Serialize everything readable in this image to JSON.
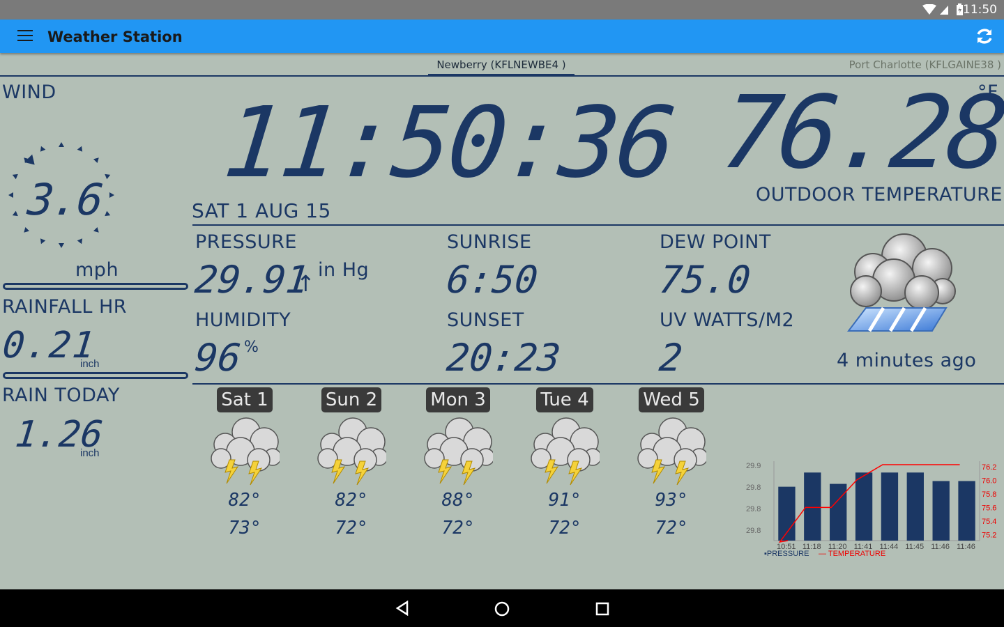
{
  "status_bar": {
    "time": "11:50"
  },
  "app_bar": {
    "title": "Weather Station"
  },
  "tabs": {
    "active": "Newberry (KFLNEWBE4 )",
    "inactive": "Port Charlotte (KFLGAINE38 )"
  },
  "wind": {
    "label": "WIND",
    "speed": "3.6",
    "unit": "mph"
  },
  "rainfall_hr": {
    "label": "RAINFALL HR",
    "value": "0.21",
    "unit": "inch"
  },
  "rain_today": {
    "label": "RAIN TODAY",
    "value": "1.26",
    "unit": "inch"
  },
  "clock": {
    "time": "11:50:36",
    "date": "SAT 1 AUG 15"
  },
  "outdoor": {
    "value": "76.28",
    "unit": "°F",
    "label": "OUTDOOR TEMPERATURE"
  },
  "pressure": {
    "label": "PRESSURE",
    "value": "29.91",
    "trend": "↑",
    "unit": "in Hg"
  },
  "humidity": {
    "label": "HUMIDITY",
    "value": "96",
    "unit": "%"
  },
  "sunrise": {
    "label": "SUNRISE",
    "value": "6:50"
  },
  "sunset": {
    "label": "SUNSET",
    "value": "20:23"
  },
  "dew_point": {
    "label": "DEW POINT",
    "value": "75.0"
  },
  "uv": {
    "label": "UV WATTS/M2",
    "value": "2"
  },
  "updated": "4 minutes ago",
  "forecast": [
    {
      "day": "Sat 1",
      "hi": "82°",
      "lo": "73°"
    },
    {
      "day": "Sun 2",
      "hi": "82°",
      "lo": "72°"
    },
    {
      "day": "Mon 3",
      "hi": "88°",
      "lo": "72°"
    },
    {
      "day": "Tue 4",
      "hi": "91°",
      "lo": "72°"
    },
    {
      "day": "Wed 5",
      "hi": "93°",
      "lo": "72°"
    }
  ],
  "colors": {
    "lcd": "#1b3764",
    "background": "#b3bfb6",
    "appbar": "#2196f3",
    "temp_line": "#ff0000"
  },
  "chart_data": {
    "type": "bar",
    "categories": [
      "10:51",
      "11:18",
      "11:20",
      "11:41",
      "11:44",
      "11:45",
      "11:46",
      "11:46"
    ],
    "series": [
      {
        "name": "PRESSURE",
        "type": "bar",
        "values": [
          29.885,
          29.91,
          29.89,
          29.91,
          29.91,
          29.91,
          29.895,
          29.895
        ]
      },
      {
        "name": "TEMPERATURE",
        "type": "line",
        "values": [
          75.08,
          75.58,
          75.58,
          75.98,
          76.2,
          76.2,
          76.2,
          76.2
        ]
      }
    ],
    "y_left": {
      "ticks": [
        "29.9",
        "29.8",
        "29.8",
        "29.8"
      ],
      "range": [
        29.79,
        29.93
      ]
    },
    "y_right": {
      "ticks": [
        "76.2",
        "76.0",
        "75.8",
        "75.6",
        "75.4",
        "75.2"
      ],
      "range": [
        75.1,
        76.25
      ]
    },
    "legend": [
      "PRESSURE",
      "TEMPERATURE"
    ]
  }
}
